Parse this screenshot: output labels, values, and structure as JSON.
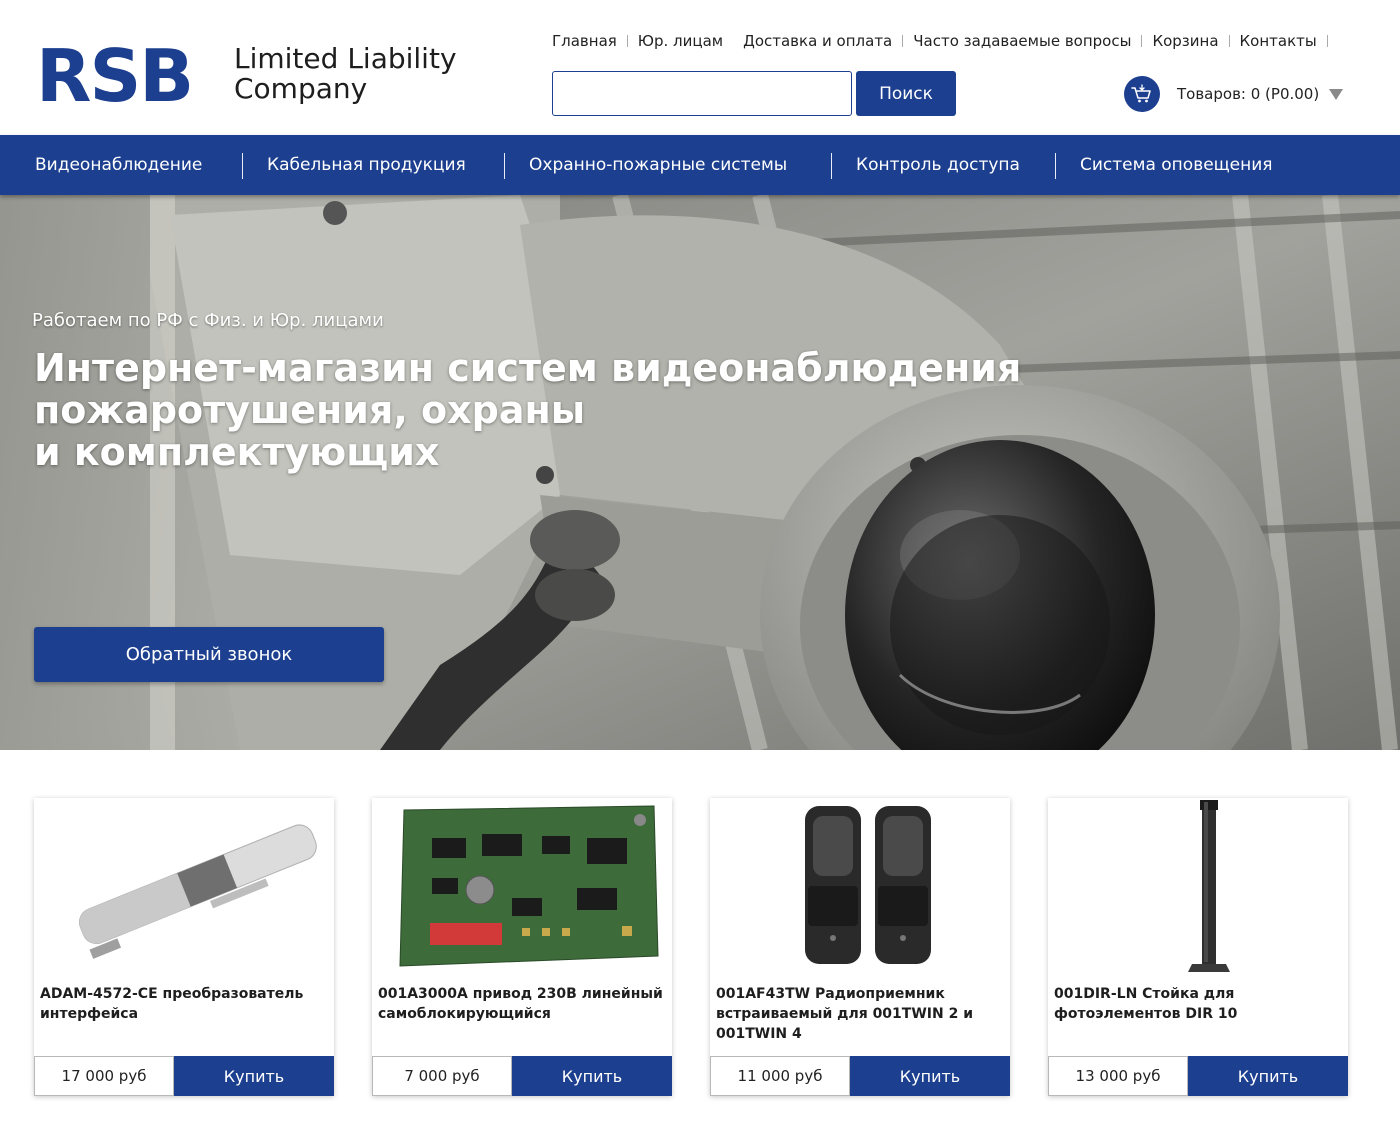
{
  "header": {
    "logo_mark": "RSB",
    "logo_line1": "Limited Liability",
    "logo_line2": "Company",
    "top_links": [
      "Главная",
      "Юр. лицам",
      "Доставка и оплата",
      "Часто задаваемые вопросы",
      "Корзина",
      "Контакты"
    ],
    "search": {
      "value": "",
      "placeholder": "",
      "button_label": "Поиск"
    },
    "cart": {
      "icon": "shopping-cart-icon",
      "label": "Товаров: 0 (Р0.00)"
    }
  },
  "nav": {
    "items": [
      "Видеонаблюдение",
      "Кабельная продукция",
      "Охранно-пожарные системы",
      "Контроль доступа",
      "Система оповещения"
    ]
  },
  "hero": {
    "subtitle": "Работаем по РФ с Физ. и Юр. лицами",
    "title_line1": "Интернет-магазин систем видеонаблюдения",
    "title_line2": "пожаротушения, охраны",
    "title_line3": "и комплектующих",
    "button_label": "Обратный звонок"
  },
  "products": [
    {
      "title": " ADAM-4572-CE преобразователь интерфейса",
      "price": "17 000 руб",
      "buy_label": "Купить"
    },
    {
      "title": "001A3000A привод 230В линейный самоблокирующийся",
      "price": "7 000 руб",
      "buy_label": "Купить"
    },
    {
      "title": "001AF43TW Радиоприемник встраиваемый для 001TWIN 2 и 001TWIN 4",
      "price": "11 000 руб",
      "buy_label": "Купить"
    },
    {
      "title": "001DIR-LN Стойка для фотоэлементов DIR 10",
      "price": "13 000 руб",
      "buy_label": "Купить"
    }
  ],
  "colors": {
    "brand": "#1c3f8f",
    "text": "#222222",
    "background": "#ffffff"
  }
}
